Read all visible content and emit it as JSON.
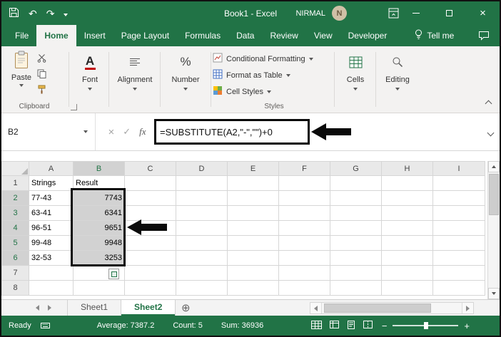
{
  "title_bar": {
    "title": "Book1 - Excel",
    "user": "NIRMAL",
    "user_initial": "N"
  },
  "ribbon": {
    "tabs": [
      {
        "label": "File"
      },
      {
        "label": "Home",
        "active": true
      },
      {
        "label": "Insert"
      },
      {
        "label": "Page Layout"
      },
      {
        "label": "Formulas"
      },
      {
        "label": "Data"
      },
      {
        "label": "Review"
      },
      {
        "label": "View"
      },
      {
        "label": "Developer"
      }
    ],
    "tell_me": "Tell me",
    "clipboard": {
      "label": "Clipboard",
      "paste_label": "Paste"
    },
    "font": {
      "label": "Font"
    },
    "alignment": {
      "label": "Alignment"
    },
    "number": {
      "label": "Number"
    },
    "styles": {
      "label": "Styles",
      "items": [
        "Conditional Formatting",
        "Format as Table",
        "Cell Styles"
      ]
    },
    "cells": {
      "label": "Cells"
    },
    "editing": {
      "label": "Editing"
    }
  },
  "formula_bar": {
    "name_box": "B2",
    "fx_label": "fx",
    "formula": "=SUBSTITUTE(A2,\"-\",\"\")+0"
  },
  "grid": {
    "columns": [
      "A",
      "B",
      "C",
      "D",
      "E",
      "F",
      "G",
      "H",
      "I"
    ],
    "selection": {
      "column": "B",
      "rows": [
        2,
        3,
        4,
        5,
        6
      ]
    },
    "rows": [
      {
        "n": 1,
        "cells": {
          "A": "Strings",
          "B": "Result"
        }
      },
      {
        "n": 2,
        "cells": {
          "A": "77-43",
          "B": "7743"
        }
      },
      {
        "n": 3,
        "cells": {
          "A": "63-41",
          "B": "6341"
        }
      },
      {
        "n": 4,
        "cells": {
          "A": "96-51",
          "B": "9651"
        }
      },
      {
        "n": 5,
        "cells": {
          "A": "99-48",
          "B": "9948"
        }
      },
      {
        "n": 6,
        "cells": {
          "A": "32-53",
          "B": "3253"
        }
      },
      {
        "n": 7,
        "cells": {}
      },
      {
        "n": 8,
        "cells": {}
      }
    ]
  },
  "sheet_bar": {
    "sheets": [
      {
        "label": "Sheet1"
      },
      {
        "label": "Sheet2",
        "active": true
      }
    ]
  },
  "status_bar": {
    "mode": "Ready",
    "average": "Average: 7387.2",
    "count": "Count: 5",
    "sum": "Sum: 36936"
  }
}
